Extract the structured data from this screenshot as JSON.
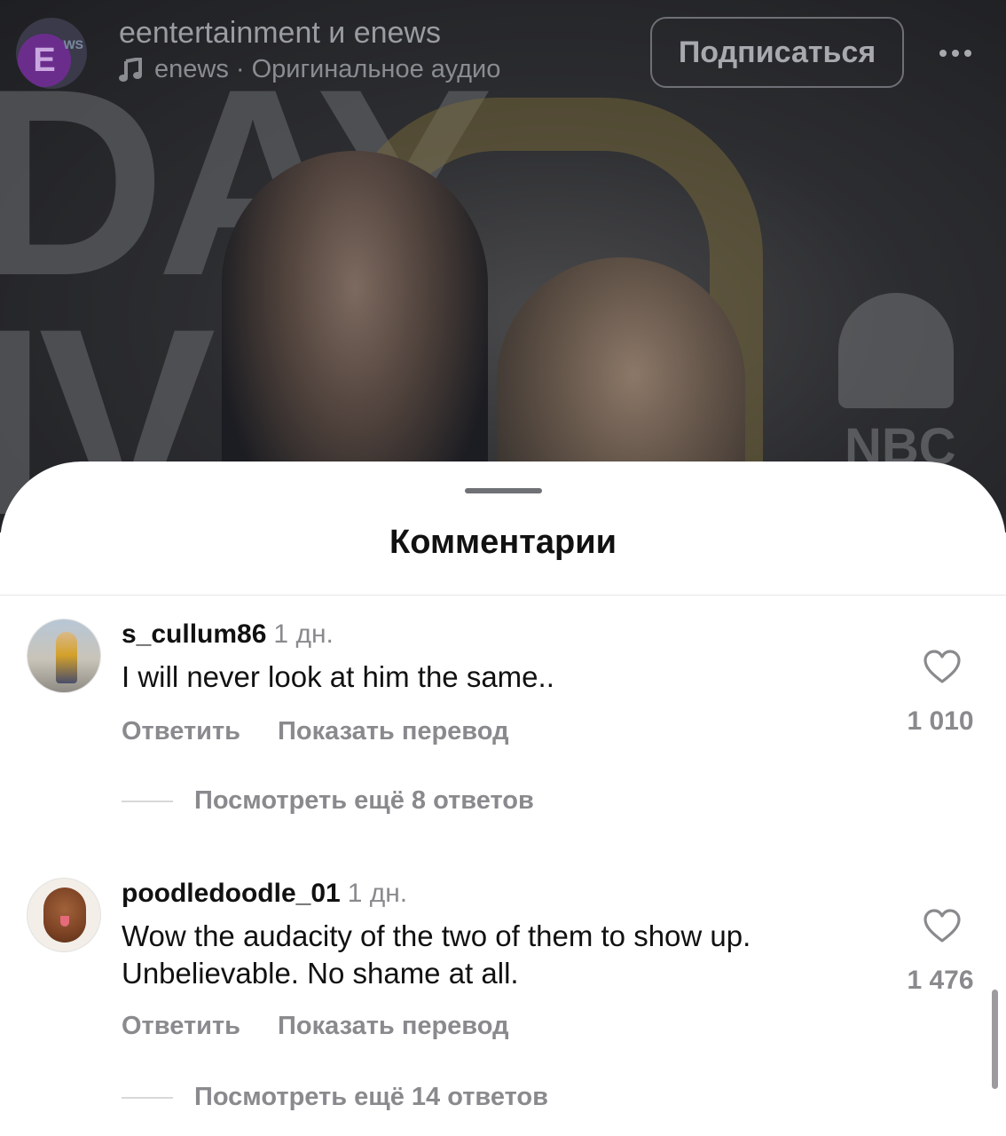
{
  "header": {
    "author": "eentertainment и enews",
    "audio": "enews · Оригинальное аудио",
    "subscribe_label": "Подписаться",
    "logo_letter": "E",
    "logo_ws": "WS"
  },
  "video": {
    "bg_letters": "DAY\nIVE",
    "nbc_text": "NBC"
  },
  "sheet": {
    "title": "Комментарии"
  },
  "comments": [
    {
      "username": "s_cullum86",
      "time": "1 дн.",
      "text": "I will never look at him the same..",
      "reply_label": "Ответить",
      "translate_label": "Показать перевод",
      "likes": "1 010",
      "more_replies": "Посмотреть ещё 8 ответов"
    },
    {
      "username": "poodledoodle_01",
      "time": "1 дн.",
      "text": "Wow the audacity of the two of them to show up. Unbelievable. No shame at all.",
      "reply_label": "Ответить",
      "translate_label": "Показать перевод",
      "likes": "1 476",
      "more_replies": "Посмотреть ещё 14 ответов"
    }
  ],
  "icons": {
    "music": "music-note-icon",
    "more": "more-horizontal-icon",
    "like": "heart-outline-icon"
  },
  "colors": {
    "sheet_bg": "#ffffff",
    "muted_text": "#8a8a8e",
    "primary_text": "#111111",
    "logo_purple": "#6b2d8c"
  }
}
